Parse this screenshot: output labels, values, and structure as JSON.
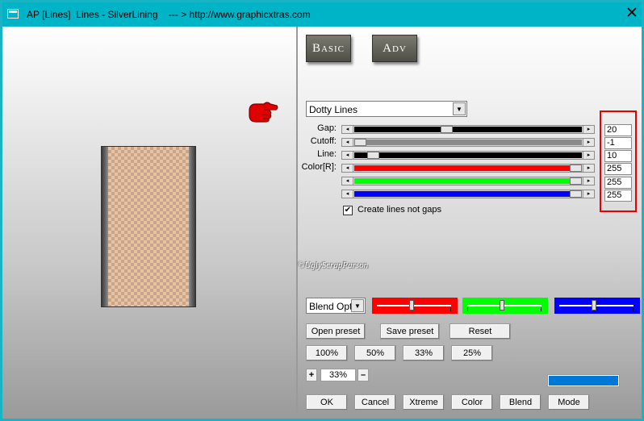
{
  "window": {
    "title": "AP [Lines]  Lines - SilverLining    --- > http://www.graphicxtras.com",
    "close_symbol": "✕"
  },
  "tabs": {
    "basic": "Basic",
    "adv": "Adv"
  },
  "preset": {
    "selected": "Dotty Lines"
  },
  "sliders": [
    {
      "label": "Gap:",
      "value": "20",
      "level_pct": 40,
      "color": "#000000"
    },
    {
      "label": "Cutoff:",
      "value": "-1",
      "level_pct": 0,
      "color": "#8a8a8a"
    },
    {
      "label": "Line:",
      "value": "10",
      "level_pct": 6,
      "color": "#000000"
    },
    {
      "label": "Color[R]:",
      "value": "255",
      "level_pct": 100,
      "color": "#ff0000"
    },
    {
      "label": "",
      "value": "255",
      "level_pct": 100,
      "color": "#00ff00"
    },
    {
      "label": "",
      "value": "255",
      "level_pct": 100,
      "color": "#0000ff"
    }
  ],
  "checkbox": {
    "label": "Create lines not gaps",
    "checked": true
  },
  "watermark": "©UglyScrapParson",
  "blend": {
    "selected": "Blend Optio"
  },
  "color_bars": [
    {
      "color": "#ff0000",
      "level_pct": 50
    },
    {
      "color": "#00ff00",
      "level_pct": 50
    },
    {
      "color": "#0000ff",
      "level_pct": 50
    }
  ],
  "buttons": {
    "open_preset": "Open preset",
    "save_preset": "Save preset",
    "reset": "Reset",
    "zoom": [
      "100%",
      "50%",
      "33%",
      "25%"
    ],
    "zoom_plus": "+",
    "zoom_minus": "–",
    "zoom_value": "33%",
    "bottom": [
      "OK",
      "Cancel",
      "Xtreme",
      "Color",
      "Blend",
      "Mode"
    ]
  },
  "swatch_color": "#0078d7"
}
